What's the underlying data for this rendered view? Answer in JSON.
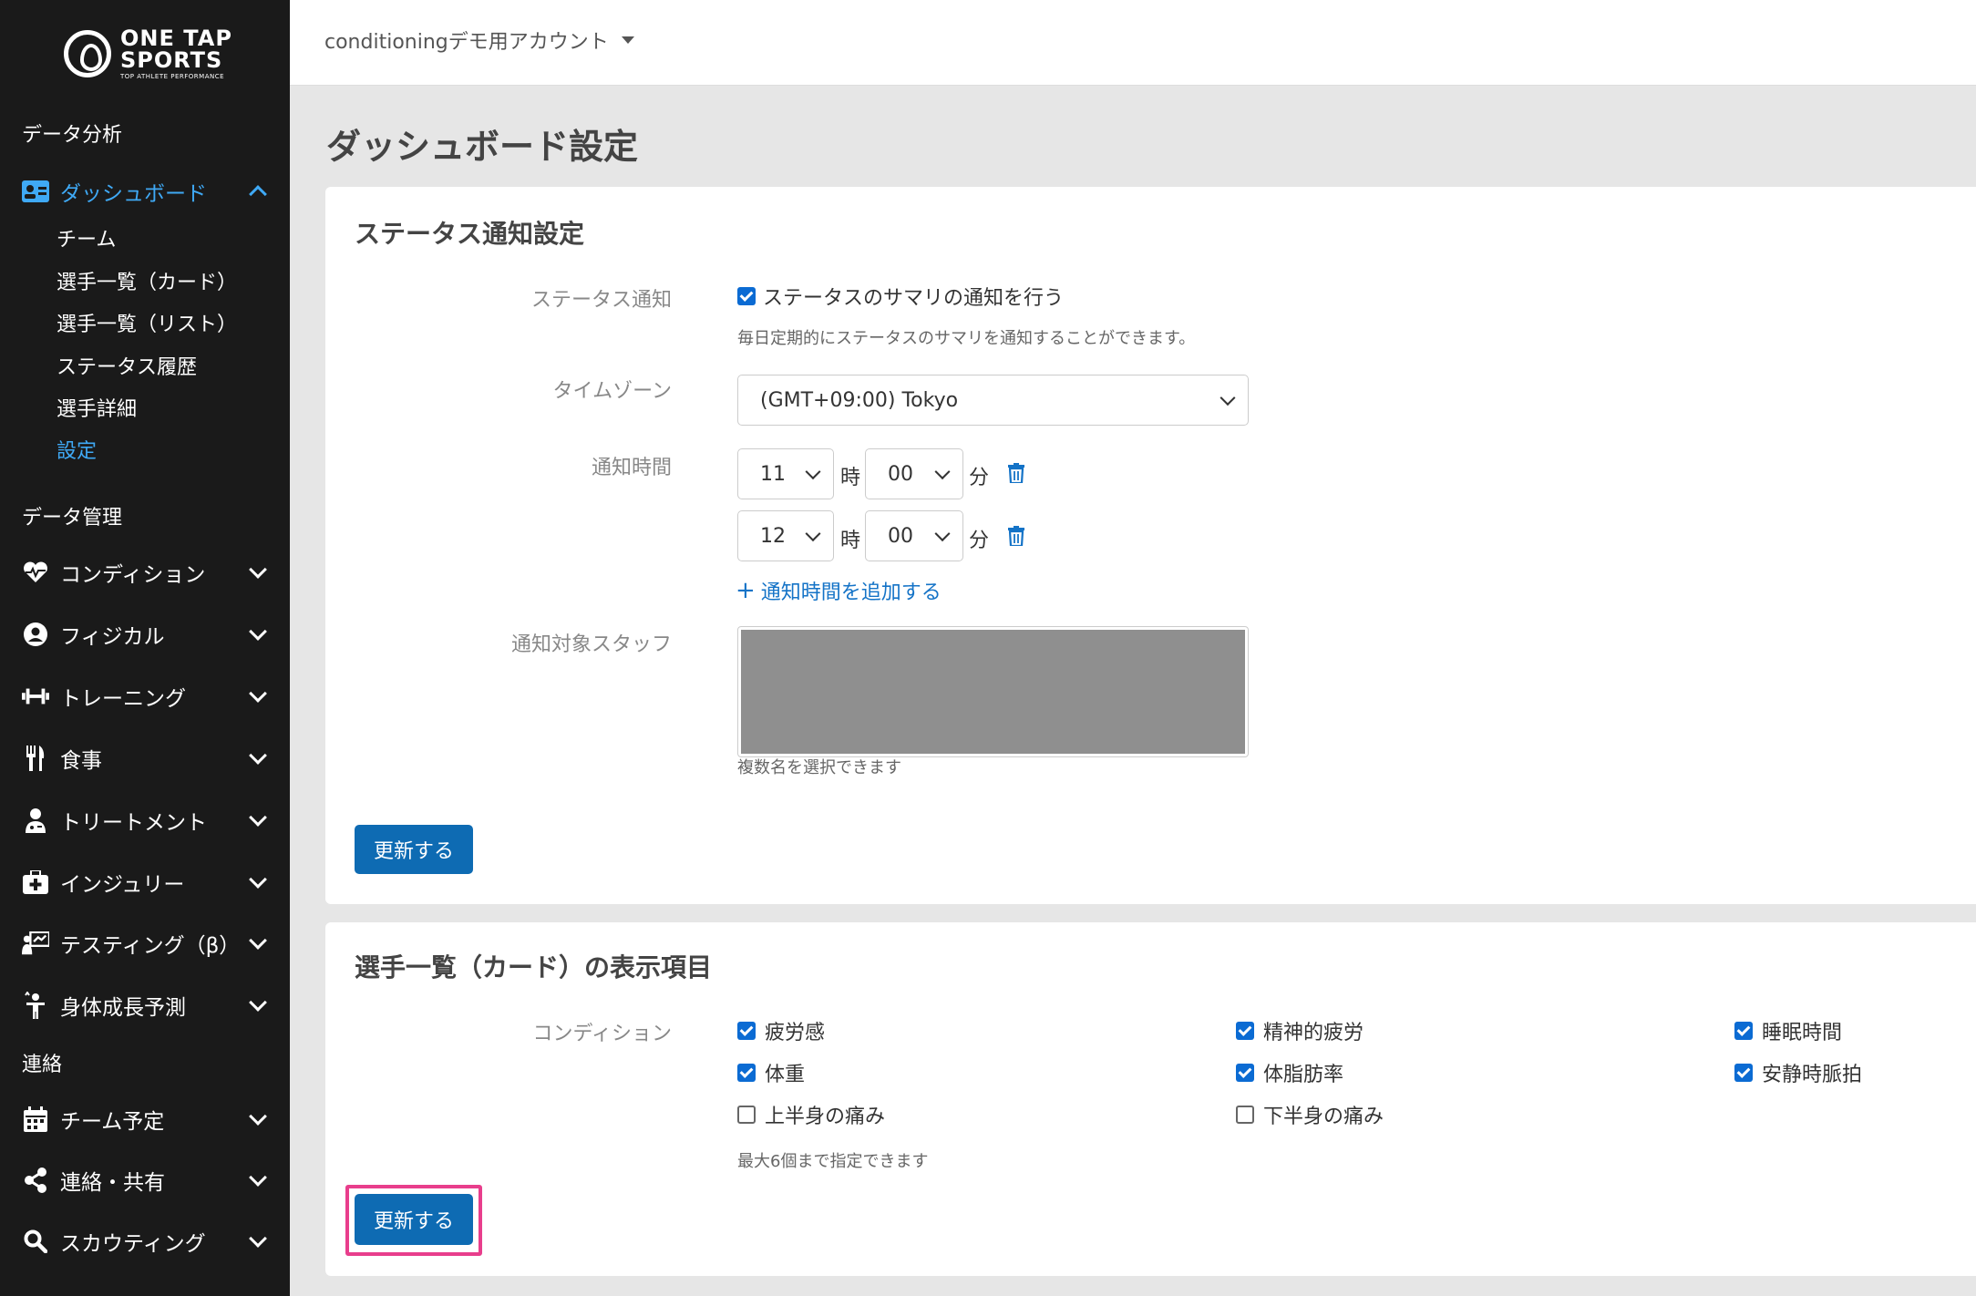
{
  "sidebar": {
    "logo": {
      "line1": "ONE TAP",
      "line2": "SPORTS",
      "sub": "TOP ATHLETE PERFORMANCE"
    },
    "section_analysis": "データ分析",
    "dashboard": "ダッシュボード",
    "dashboard_subs": [
      "チーム",
      "選手一覧（カード）",
      "選手一覧（リスト）",
      "ステータス履歴",
      "選手詳細",
      "設定"
    ],
    "section_manage": "データ管理",
    "manage_items": [
      "コンディション",
      "フィジカル",
      "トレーニング",
      "食事",
      "トリートメント",
      "インジュリー",
      "テスティング（β）",
      "身体成長予測"
    ],
    "section_contact": "連絡",
    "contact_items": [
      "チーム予定",
      "連絡・共有",
      "スカウティング"
    ]
  },
  "topbar": {
    "account": "conditioningデモ用アカウント"
  },
  "page_title": "ダッシュボード設定",
  "status_card": {
    "title": "ステータス通知設定",
    "notify_label": "ステータス通知",
    "notify_checkbox": "ステータスのサマリの通知を行う",
    "notify_help": "毎日定期的にステータスのサマリを通知することができます。",
    "timezone_label": "タイムゾーン",
    "timezone_value": "(GMT+09:00) Tokyo",
    "time_label": "通知時間",
    "times": [
      {
        "hour": "11",
        "minute": "00"
      },
      {
        "hour": "12",
        "minute": "00"
      }
    ],
    "hour_unit": "時",
    "minute_unit": "分",
    "add_time": "通知時間を追加する",
    "staff_label": "通知対象スタッフ",
    "staff_help": "複数名を選択できます",
    "submit": "更新する"
  },
  "card_card": {
    "title": "選手一覧（カード）の表示項目",
    "condition_label": "コンディション",
    "options": [
      {
        "label": "疲労感",
        "checked": true
      },
      {
        "label": "精神的疲労",
        "checked": true
      },
      {
        "label": "睡眠時間",
        "checked": true
      },
      {
        "label": "体重",
        "checked": true
      },
      {
        "label": "体脂肪率",
        "checked": true
      },
      {
        "label": "安静時脈拍",
        "checked": true
      },
      {
        "label": "上半身の痛み",
        "checked": false
      },
      {
        "label": "下半身の痛み",
        "checked": false
      }
    ],
    "help": "最大6個まで指定できます",
    "submit": "更新する"
  }
}
